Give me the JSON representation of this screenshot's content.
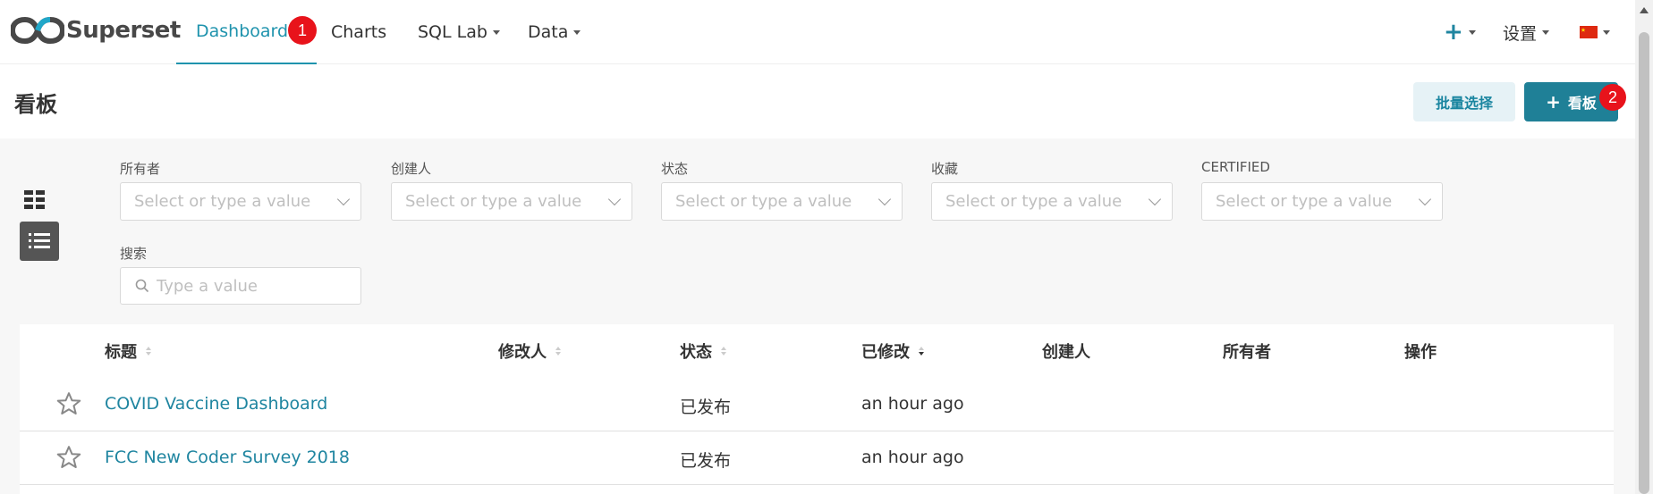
{
  "brand": {
    "name": "Superset"
  },
  "nav": {
    "dashboards": "Dashboards",
    "charts": "Charts",
    "sql_lab": "SQL Lab",
    "data": "Data",
    "plus": "+",
    "settings": "设置",
    "active": "Dashboards"
  },
  "badges": {
    "one": "1",
    "two": "2"
  },
  "header": {
    "title": "看板",
    "bulk_select": "批量选择",
    "add_dashboard": "看板"
  },
  "filters": {
    "owner": {
      "label": "所有者",
      "placeholder": "Select or type a value"
    },
    "creator": {
      "label": "创建人",
      "placeholder": "Select or type a value"
    },
    "status": {
      "label": "状态",
      "placeholder": "Select or type a value"
    },
    "favorite": {
      "label": "收藏",
      "placeholder": "Select or type a value"
    },
    "certified": {
      "label": "CERTIFIED",
      "placeholder": "Select or type a value"
    },
    "search": {
      "label": "搜索",
      "placeholder": "Type a value"
    }
  },
  "table": {
    "columns": {
      "title": "标题",
      "modified_by": "修改人",
      "status": "状态",
      "modified": "已修改",
      "created_by": "创建人",
      "owners": "所有者",
      "actions": "操作"
    },
    "rows": [
      {
        "title": "COVID Vaccine Dashboard",
        "status": "已发布",
        "modified": "an hour ago"
      },
      {
        "title": "FCC New Coder Survey 2018",
        "status": "已发布",
        "modified": "an hour ago"
      }
    ]
  },
  "colors": {
    "accent": "#1f93ad",
    "primary_button": "#1f8097",
    "badge": "#e8131b"
  }
}
